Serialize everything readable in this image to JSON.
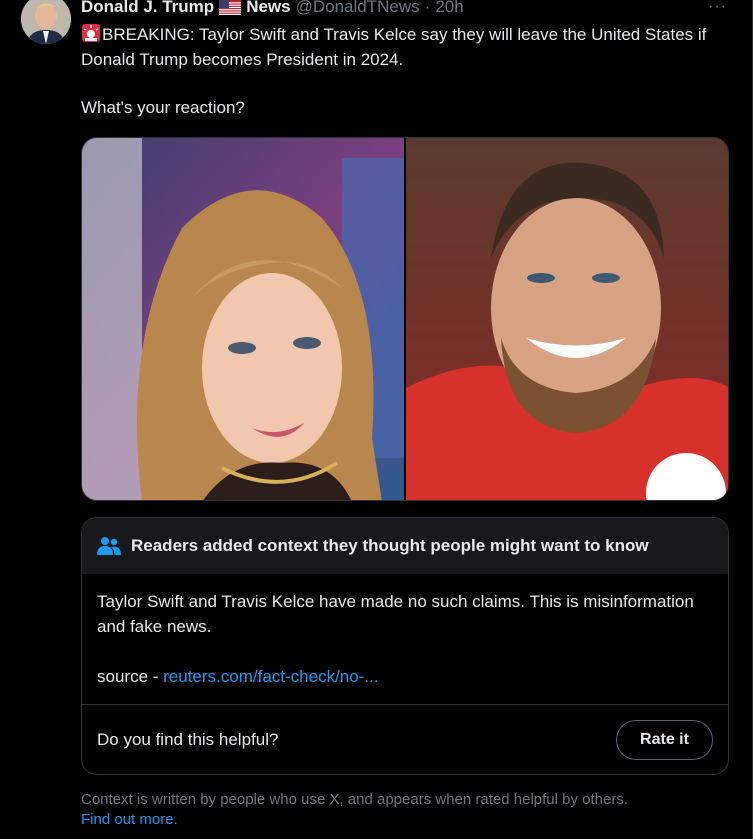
{
  "tweet": {
    "author_name": "Donald J. Trump",
    "flag_icon": "us-flag-icon",
    "author_suffix": "News",
    "handle": "@DonaldTNews",
    "separator": "·",
    "time": "20h",
    "more_label": "···",
    "siren_icon": "police-light-icon",
    "text_line1": "BREAKING: Taylor Swift and Travis Kelce say they will leave the United States if Donald Trump becomes President in 2024.",
    "text_line2": "What's your reaction?"
  },
  "media": {
    "photos": [
      "photo-taylor-swift",
      "photo-travis-kelce"
    ]
  },
  "community_note": {
    "icon": "people-icon",
    "heading": "Readers added context they thought people might want to know",
    "body": "Taylor Swift and Travis Kelce have made no such claims. This is misinformation and fake news.",
    "source_label": "source - ",
    "source_link": "reuters.com/fact-check/no-...",
    "helpful_question": "Do you find this helpful?",
    "rate_button": "Rate it"
  },
  "footer": {
    "text": "Context is written by people who use X, and appears when rated helpful by others.",
    "link": "Find out more."
  },
  "colors": {
    "background": "#000000",
    "text": "#e7e9ea",
    "muted": "#71767b",
    "link": "#1d9bf0",
    "border": "#2f3336",
    "note_header": "#16181c"
  }
}
